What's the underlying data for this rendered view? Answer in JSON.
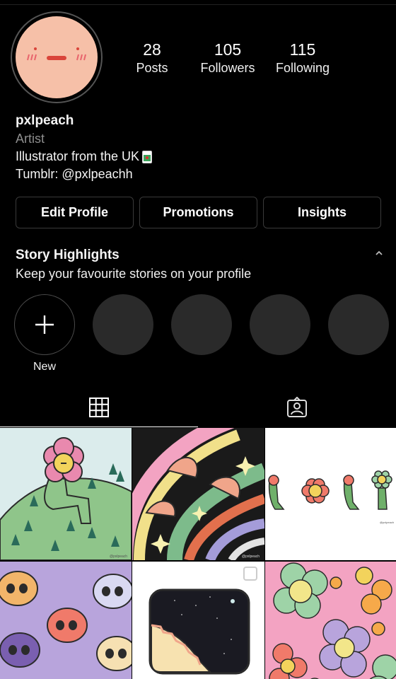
{
  "profile": {
    "username": "pxlpeach",
    "category": "Artist",
    "bio_line1": "Illustrator from the UK",
    "bio_line2": "Tumblr: @pxlpeachh"
  },
  "stats": {
    "posts": {
      "count": "28",
      "label": "Posts"
    },
    "followers": {
      "count": "105",
      "label": "Followers"
    },
    "following": {
      "count": "115",
      "label": "Following"
    }
  },
  "buttons": {
    "edit_profile": "Edit Profile",
    "promotions": "Promotions",
    "insights": "Insights"
  },
  "story_highlights": {
    "title": "Story Highlights",
    "subtitle": "Keep your favourite stories on your profile",
    "new_label": "New"
  },
  "posts": [
    {
      "icon": "flower-person-illustration",
      "watermark": "@pxlpeach"
    },
    {
      "icon": "mushroom-rainbow-illustration",
      "watermark": "@pxlpeach"
    },
    {
      "icon": "flower-characters-illustration",
      "watermark": "@pxlpeach"
    },
    {
      "icon": "skulls-illustration"
    },
    {
      "icon": "night-sky-window-illustration"
    },
    {
      "icon": "flowers-pattern-illustration"
    }
  ],
  "colors": {
    "background": "#000000",
    "button_border": "#3a3a3a",
    "placeholder_circle": "#2a2a2a",
    "avatar_skin": "#f6c0a8"
  }
}
